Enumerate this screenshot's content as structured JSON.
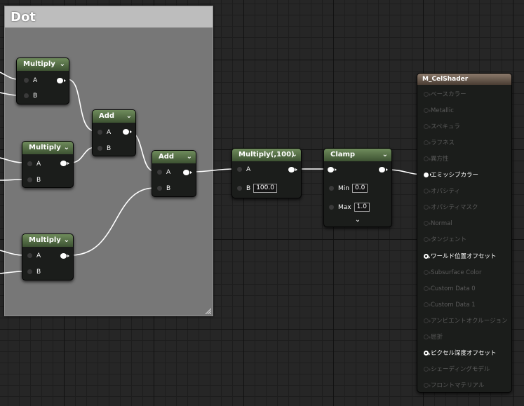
{
  "comment": {
    "title": "Dot"
  },
  "nodes": {
    "multiply1": {
      "title": "Multiply",
      "pin_a": "A",
      "pin_b": "B"
    },
    "multiply2": {
      "title": "Multiply",
      "pin_a": "A",
      "pin_b": "B"
    },
    "multiply3": {
      "title": "Multiply",
      "pin_a": "A",
      "pin_b": "B"
    },
    "add1": {
      "title": "Add",
      "pin_a": "A",
      "pin_b": "B"
    },
    "add2": {
      "title": "Add",
      "pin_a": "A",
      "pin_b": "B"
    },
    "multiply100": {
      "title": "Multiply(,100)",
      "pin_a": "A",
      "pin_b": "B",
      "b_value": "100.0"
    },
    "clamp": {
      "title": "Clamp",
      "min_label": "Min",
      "min_value": "0.0",
      "max_label": "Max",
      "max_value": "1.0"
    }
  },
  "result": {
    "title": "M_CelShader",
    "pins": [
      {
        "label": "ベースカラー",
        "state": "dim"
      },
      {
        "label": "Metallic",
        "state": "dim"
      },
      {
        "label": "スペキュラ",
        "state": "dim"
      },
      {
        "label": "ラフネス",
        "state": "dim"
      },
      {
        "label": "異方性",
        "state": "dim"
      },
      {
        "label": "エミッシブカラー",
        "state": "connected"
      },
      {
        "label": "オパシティ",
        "state": "dim"
      },
      {
        "label": "オパシティマスク",
        "state": "dim"
      },
      {
        "label": "Normal",
        "state": "dim"
      },
      {
        "label": "タンジェント",
        "state": "dim"
      },
      {
        "label": "ワールド位置オフセット",
        "state": "active"
      },
      {
        "label": "Subsurface Color",
        "state": "dim"
      },
      {
        "label": "Custom Data 0",
        "state": "dim"
      },
      {
        "label": "Custom Data 1",
        "state": "dim"
      },
      {
        "label": "アンビエントオクルージョン",
        "state": "dim"
      },
      {
        "label": "屈折",
        "state": "dim"
      },
      {
        "label": "ピクセル深度オフセット",
        "state": "active"
      },
      {
        "label": "シェーディングモデル",
        "state": "dim"
      },
      {
        "label": "フロントマテリアル",
        "state": "dim"
      }
    ]
  },
  "colors": {
    "grid_background": "#262626",
    "comment_background": "#777777",
    "node_header_green": "#5a7548",
    "result_header_brown": "#6e5c4e",
    "wire": "#ffffff"
  },
  "icons": {
    "dropdown": "chevron-down-icon",
    "expand": "chevron-down-icon",
    "resize": "resize-grip-icon"
  }
}
